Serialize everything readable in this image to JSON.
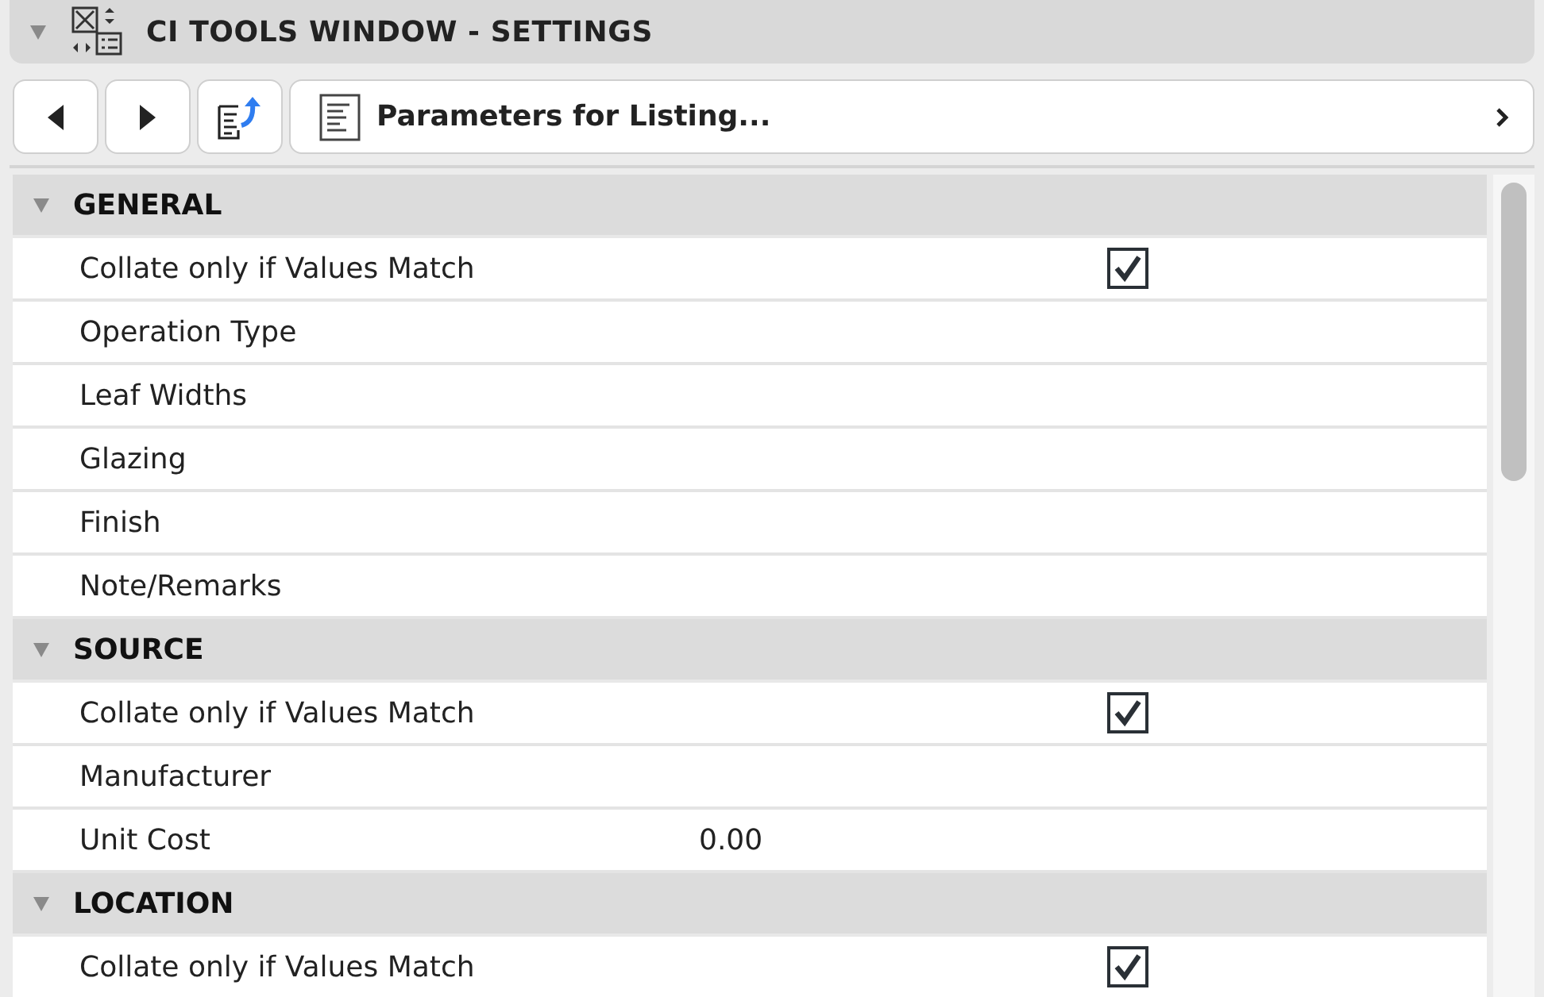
{
  "window": {
    "title": "CI TOOLS WINDOW - SETTINGS",
    "expanded": true
  },
  "toolbar": {
    "path": "Parameters for Listing..."
  },
  "sections": [
    {
      "title": "GENERAL",
      "expanded": true,
      "rows": [
        {
          "kind": "checkbox",
          "label": "Collate only if Values Match",
          "checked": true
        },
        {
          "kind": "plain",
          "label": "Operation Type"
        },
        {
          "kind": "plain",
          "label": "Leaf Widths"
        },
        {
          "kind": "plain",
          "label": "Glazing"
        },
        {
          "kind": "plain",
          "label": "Finish"
        },
        {
          "kind": "plain",
          "label": "Note/Remarks"
        }
      ]
    },
    {
      "title": "SOURCE",
      "expanded": true,
      "rows": [
        {
          "kind": "checkbox",
          "label": "Collate only if Values Match",
          "checked": true
        },
        {
          "kind": "plain",
          "label": "Manufacturer"
        },
        {
          "kind": "value",
          "label": "Unit Cost",
          "value": "0.00"
        }
      ]
    },
    {
      "title": "LOCATION",
      "expanded": true,
      "rows": [
        {
          "kind": "checkbox",
          "label": "Collate only if Values Match",
          "checked": true
        }
      ]
    }
  ]
}
